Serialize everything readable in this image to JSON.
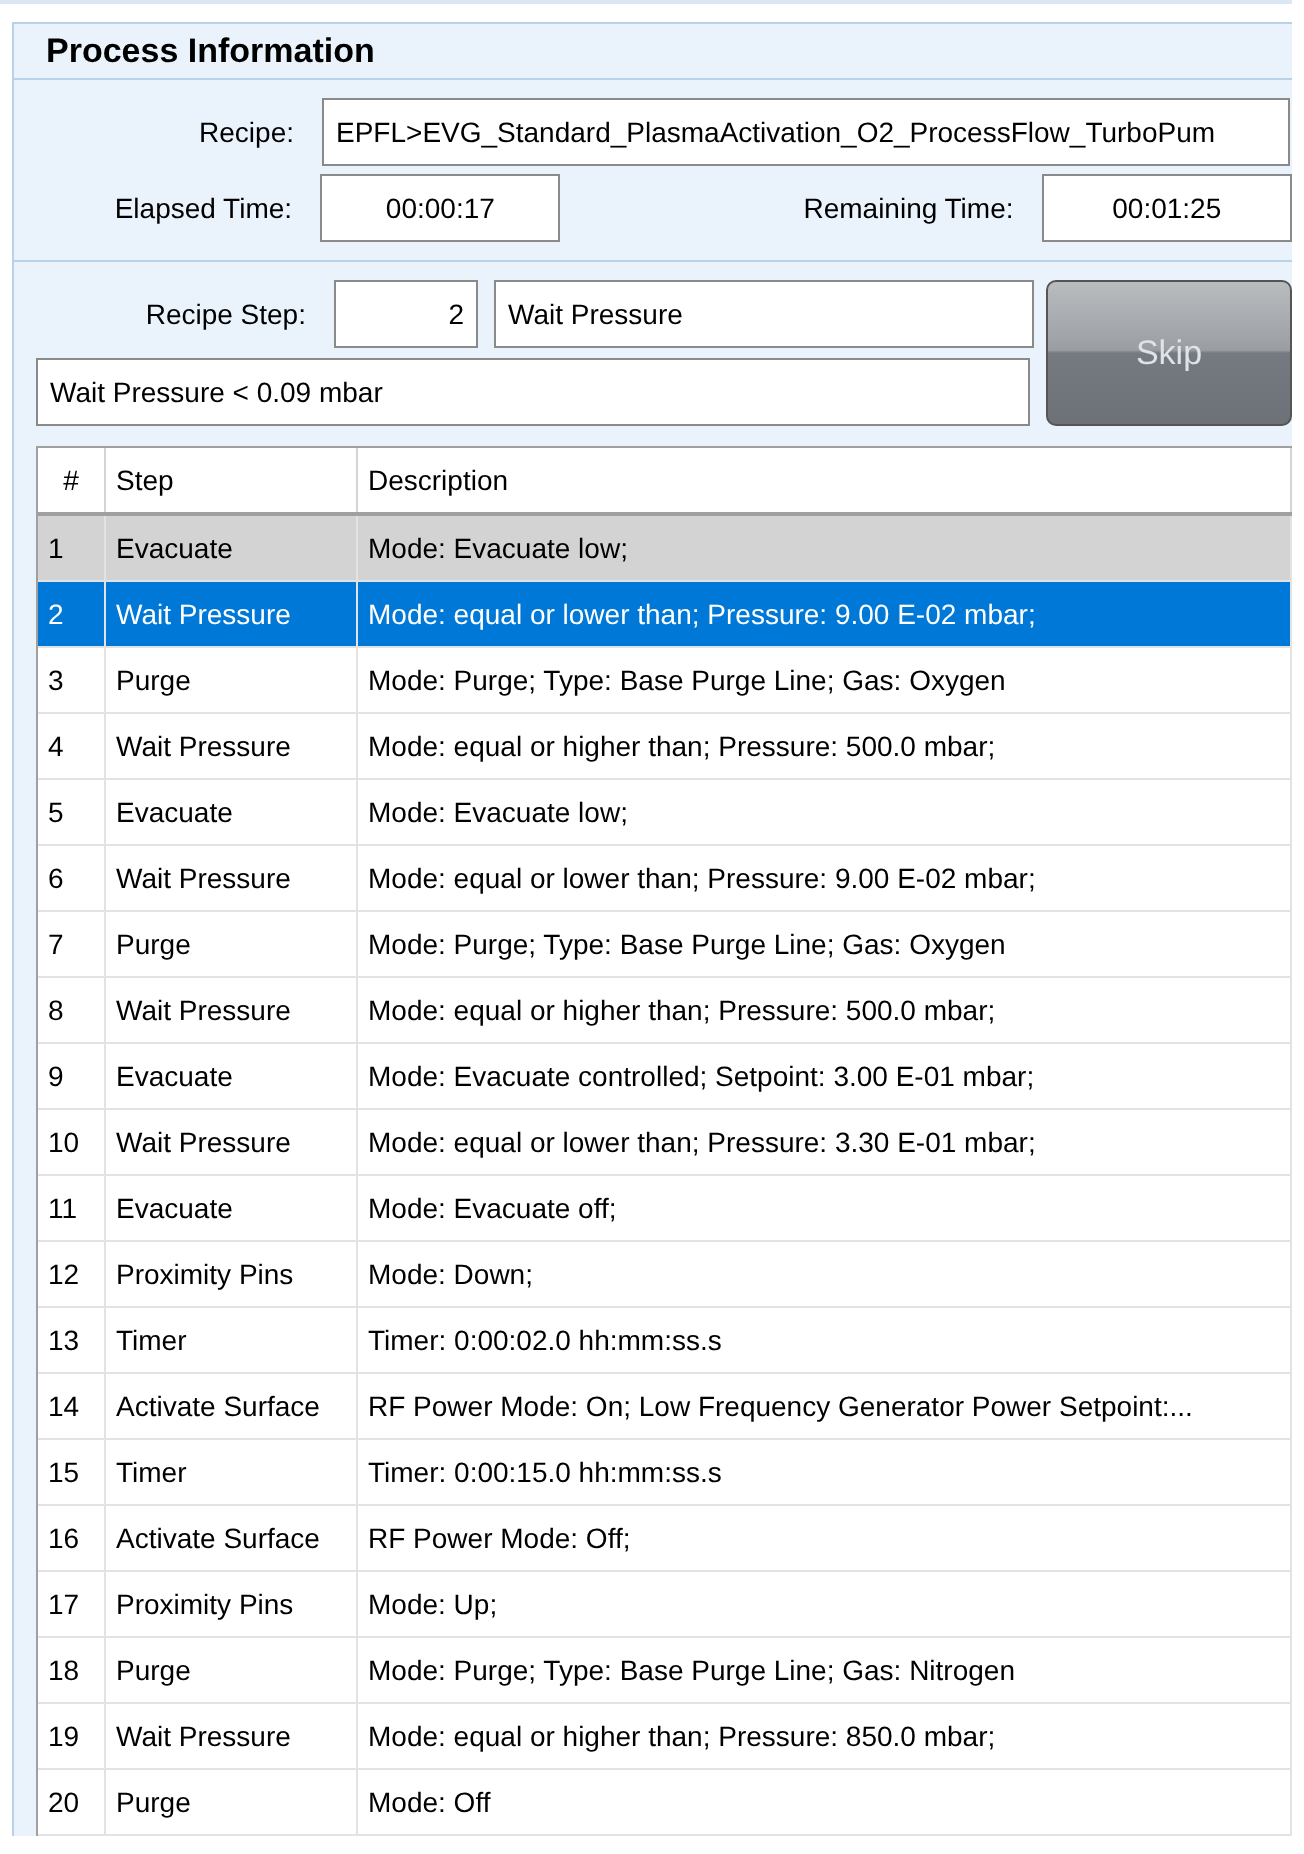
{
  "panel": {
    "title": "Process Information"
  },
  "recipe": {
    "label": "Recipe:",
    "value": "EPFL>EVG_Standard_PlasmaActivation_O2_ProcessFlow_TurboPum"
  },
  "elapsed": {
    "label": "Elapsed Time:",
    "value": "00:00:17"
  },
  "remaining": {
    "label": "Remaining Time:",
    "value": "00:01:25"
  },
  "recipe_step": {
    "label": "Recipe Step:",
    "number": "2",
    "name": "Wait Pressure",
    "condition": "Wait Pressure < 0.09 mbar"
  },
  "skip_button": {
    "label": "Skip",
    "disabled": true
  },
  "table": {
    "columns": [
      "#",
      "Step",
      "Description"
    ],
    "rows": [
      {
        "cells": [
          "1",
          "Evacuate",
          "Mode: Evacuate low;"
        ],
        "selected": false,
        "completed": true
      },
      {
        "cells": [
          "2",
          "Wait Pressure",
          "Mode: equal or lower than; Pressure: 9.00 E-02 mbar;"
        ],
        "selected": true,
        "completed": false
      },
      {
        "cells": [
          "3",
          "Purge",
          "Mode: Purge; Type: Base Purge Line; Gas: Oxygen"
        ],
        "selected": false,
        "completed": false
      },
      {
        "cells": [
          "4",
          "Wait Pressure",
          "Mode: equal or higher than; Pressure: 500.0 mbar;"
        ],
        "selected": false,
        "completed": false
      },
      {
        "cells": [
          "5",
          "Evacuate",
          "Mode: Evacuate low;"
        ],
        "selected": false,
        "completed": false
      },
      {
        "cells": [
          "6",
          "Wait Pressure",
          "Mode: equal or lower than; Pressure: 9.00 E-02 mbar;"
        ],
        "selected": false,
        "completed": false
      },
      {
        "cells": [
          "7",
          "Purge",
          "Mode: Purge; Type: Base Purge Line; Gas: Oxygen"
        ],
        "selected": false,
        "completed": false
      },
      {
        "cells": [
          "8",
          "Wait Pressure",
          "Mode: equal or higher than; Pressure: 500.0 mbar;"
        ],
        "selected": false,
        "completed": false
      },
      {
        "cells": [
          "9",
          "Evacuate",
          "Mode: Evacuate controlled; Setpoint: 3.00 E-01 mbar;"
        ],
        "selected": false,
        "completed": false
      },
      {
        "cells": [
          "10",
          "Wait Pressure",
          "Mode: equal or lower than; Pressure: 3.30 E-01 mbar;"
        ],
        "selected": false,
        "completed": false
      },
      {
        "cells": [
          "11",
          "Evacuate",
          "Mode: Evacuate off;"
        ],
        "selected": false,
        "completed": false
      },
      {
        "cells": [
          "12",
          "Proximity Pins",
          "Mode: Down;"
        ],
        "selected": false,
        "completed": false
      },
      {
        "cells": [
          "13",
          "Timer",
          "Timer: 0:00:02.0 hh:mm:ss.s"
        ],
        "selected": false,
        "completed": false
      },
      {
        "cells": [
          "14",
          "Activate Surface",
          "RF Power Mode: On; Low Frequency Generator Power Setpoint:..."
        ],
        "selected": false,
        "completed": false
      },
      {
        "cells": [
          "15",
          "Timer",
          "Timer: 0:00:15.0 hh:mm:ss.s"
        ],
        "selected": false,
        "completed": false
      },
      {
        "cells": [
          "16",
          "Activate Surface",
          "RF Power Mode: Off;"
        ],
        "selected": false,
        "completed": false
      },
      {
        "cells": [
          "17",
          "Proximity Pins",
          "Mode: Up;"
        ],
        "selected": false,
        "completed": false
      },
      {
        "cells": [
          "18",
          "Purge",
          "Mode: Purge; Type: Base Purge Line; Gas: Nitrogen"
        ],
        "selected": false,
        "completed": false
      },
      {
        "cells": [
          "19",
          "Wait Pressure",
          "Mode: equal or higher than; Pressure: 850.0 mbar;"
        ],
        "selected": false,
        "completed": false
      },
      {
        "cells": [
          "20",
          "Purge",
          "Mode: Off"
        ],
        "selected": false,
        "completed": false
      }
    ]
  }
}
